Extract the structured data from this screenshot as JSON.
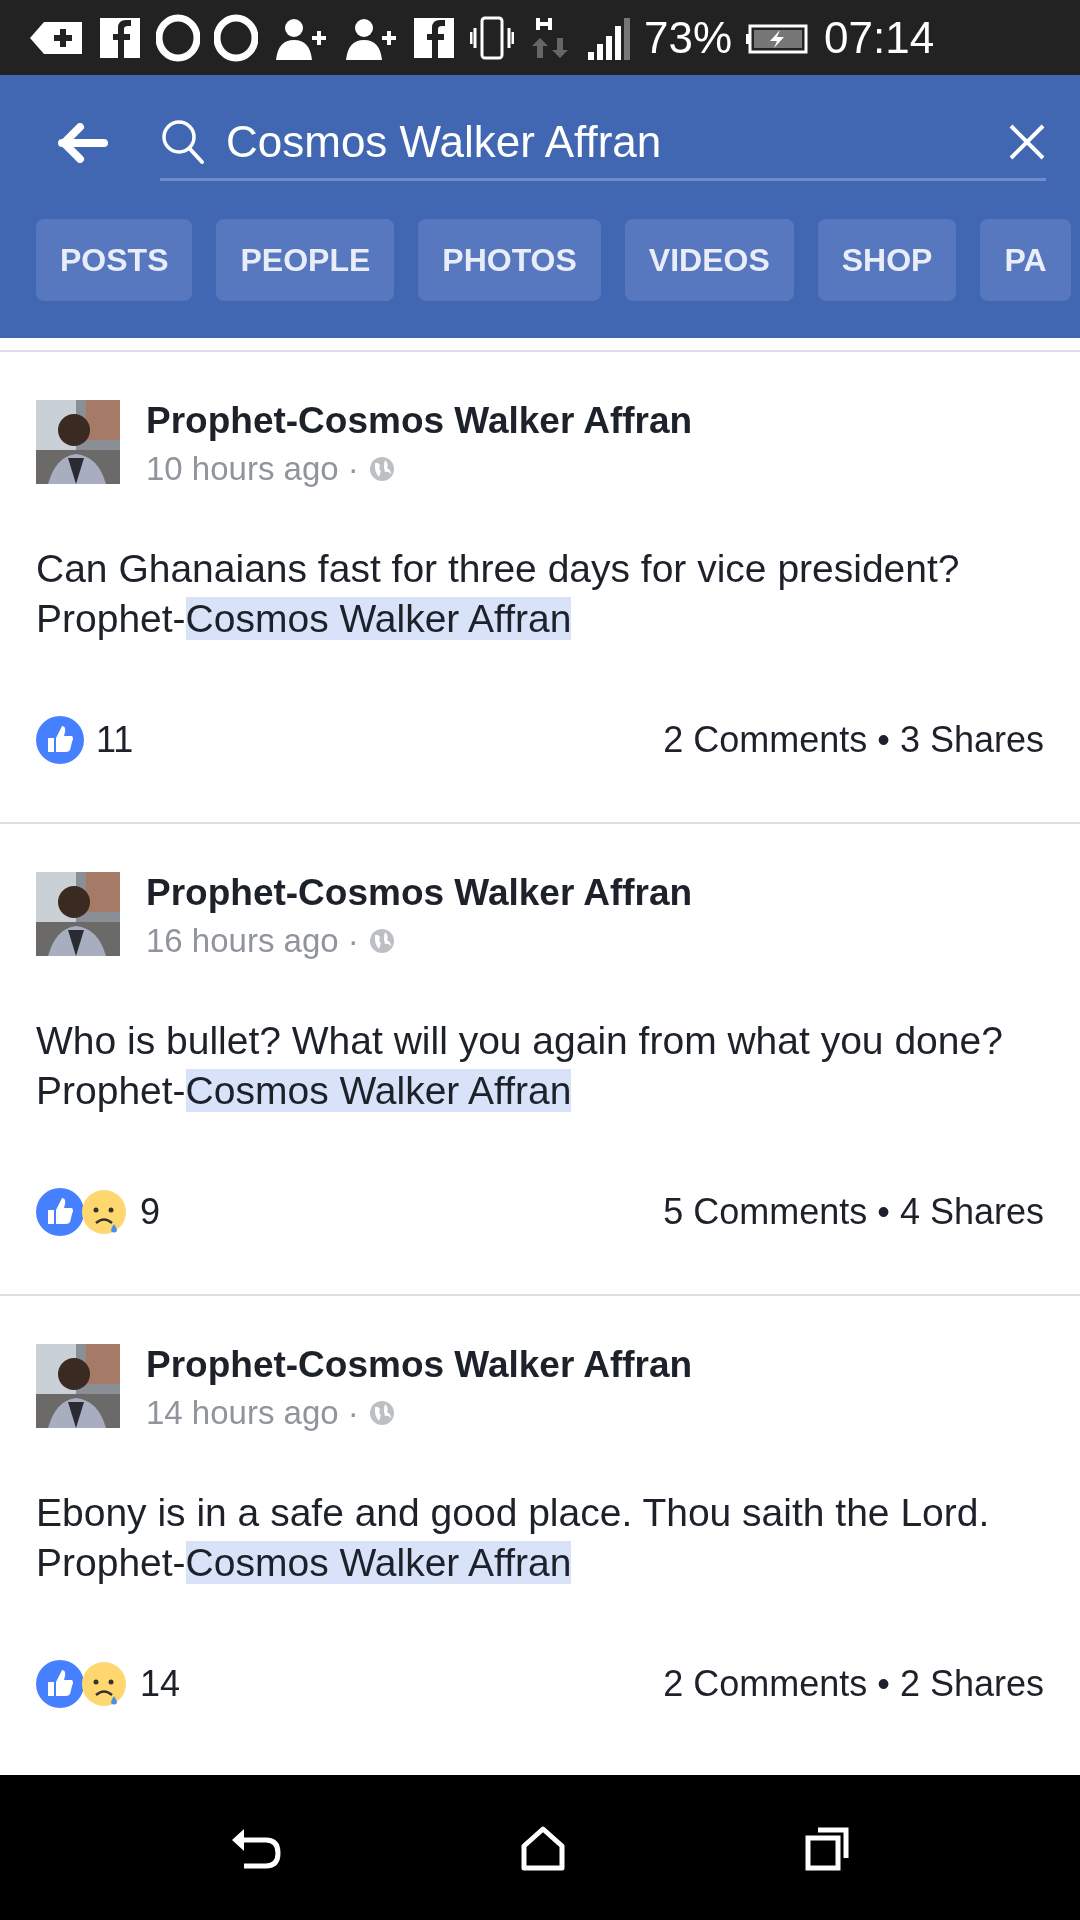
{
  "status_bar": {
    "battery": "73%",
    "time": "07:14"
  },
  "search": {
    "value": "Cosmos Walker Affran"
  },
  "tabs": [
    {
      "label": "POSTS",
      "selected": false
    },
    {
      "label": "PEOPLE",
      "selected": false
    },
    {
      "label": "PHOTOS",
      "selected": false
    },
    {
      "label": "VIDEOS",
      "selected": false
    },
    {
      "label": "SHOP",
      "selected": false
    },
    {
      "label": "PA",
      "selected": false
    }
  ],
  "posts": [
    {
      "author": "Prophet-Cosmos Walker Affran",
      "time": "10 hours ago ·",
      "text": "Can Ghanaians fast for three days for vice president? Prophet-",
      "match": "Cosmos Walker Affran",
      "reactions": [
        {
          "kind": "like"
        }
      ],
      "reaction_count": "11",
      "engagement": "2 Comments • 3 Shares"
    },
    {
      "author": "Prophet-Cosmos Walker Affran",
      "time": "16 hours ago ·",
      "text": "Who is bullet? What will you again from what you done? Prophet-",
      "match": "Cosmos Walker Affran",
      "reactions": [
        {
          "kind": "like"
        },
        {
          "kind": "sad"
        }
      ],
      "reaction_count": "9",
      "engagement": "5 Comments • 4 Shares"
    },
    {
      "author": "Prophet-Cosmos Walker Affran",
      "time": "14 hours ago ·",
      "text": "Ebony is in a safe and good place. Thou saith the Lord. Prophet-",
      "match": "Cosmos Walker Affran",
      "reactions": [
        {
          "kind": "like"
        },
        {
          "kind": "sad"
        }
      ],
      "reaction_count": "14",
      "engagement": "2 Comments • 2 Shares"
    }
  ]
}
